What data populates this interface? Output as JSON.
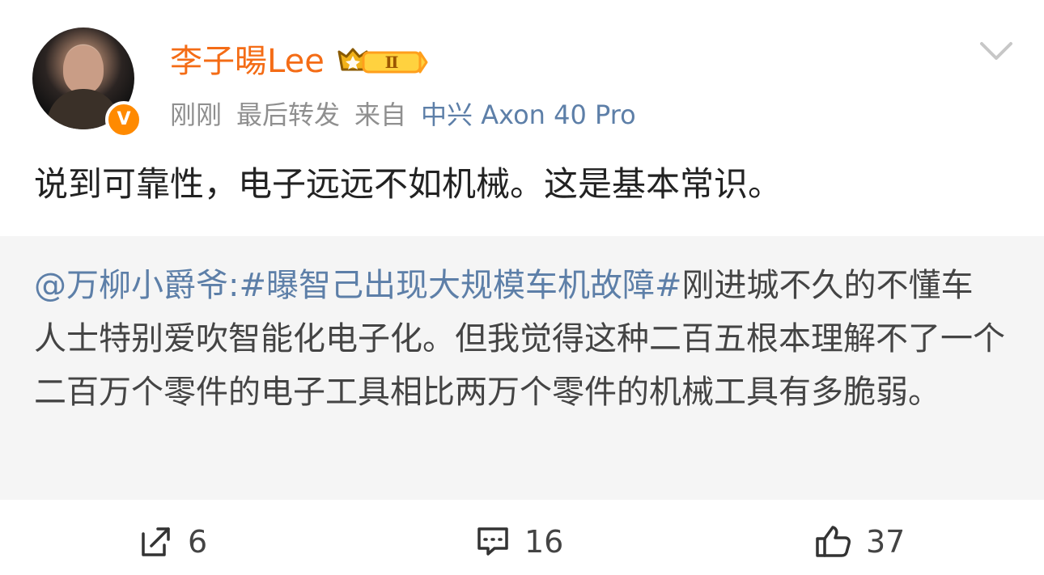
{
  "author": {
    "name": "李子暘Lee",
    "level": "Ⅱ",
    "verified_mark": "V",
    "time": "刚刚",
    "action": "最后转发",
    "source_prefix": "来自",
    "device": "中兴 Axon 40 Pro"
  },
  "post": {
    "text": "说到可靠性，电子远远不如机械。这是基本常识。"
  },
  "quote": {
    "mention": "@万柳小爵爷:",
    "hashtag": "#曝智己出现大规模车机故障#",
    "text": "刚进城不久的不懂车人士特别爱吹智能化电子化。但我觉得这种二百五根本理解不了一个二百万个零件的电子工具相比两万个零件的机械工具有多脆弱。"
  },
  "actions": {
    "repost_count": "6",
    "comment_count": "16",
    "like_count": "37"
  },
  "colors": {
    "username": "#f46c16",
    "link": "#5d7fa8",
    "muted": "#8f8f8f",
    "quote_background": "#f5f5f5",
    "badge": "#ff8a00"
  },
  "icons": {
    "dropdown": "chevron-down-icon",
    "repost": "repost-icon",
    "comment": "comment-icon",
    "like": "thumbs-up-icon",
    "level": "crown-icon"
  }
}
